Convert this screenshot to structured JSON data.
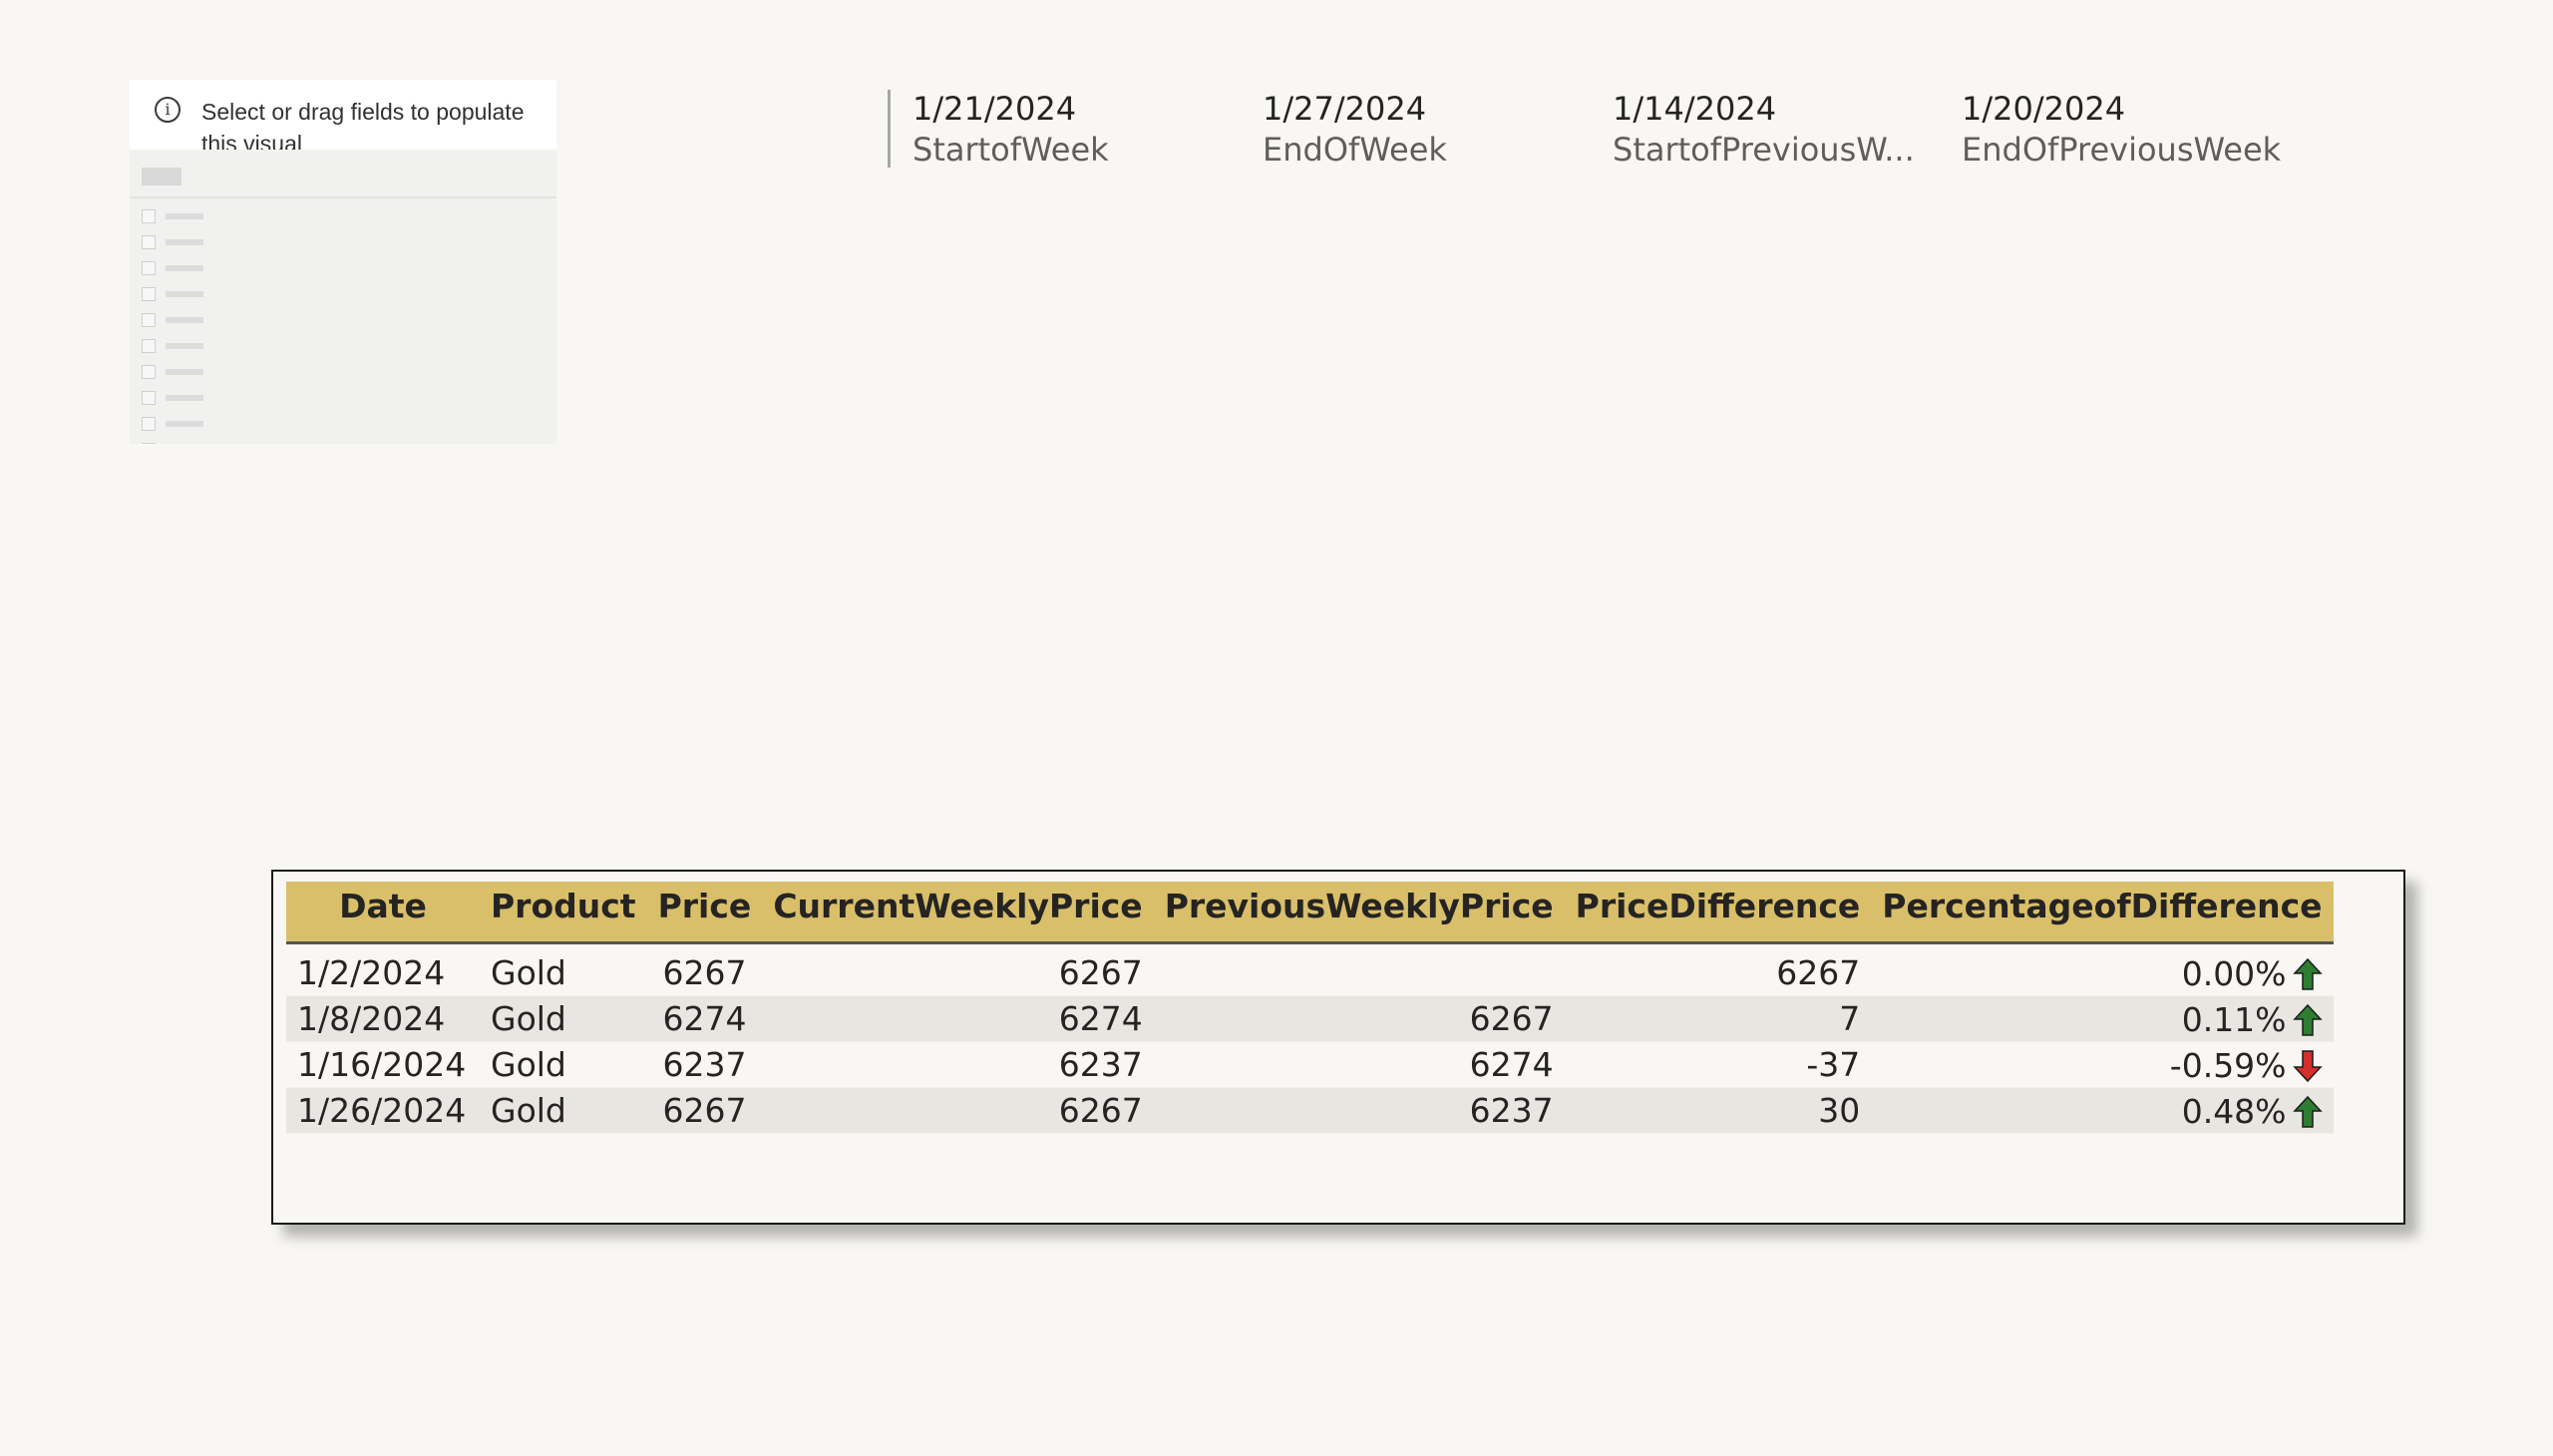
{
  "slicer": {
    "message": "Select or drag fields to populate this visual",
    "icon": "info-icon"
  },
  "cards": [
    {
      "value": "1/21/2024",
      "label": "StartofWeek"
    },
    {
      "value": "1/27/2024",
      "label": "EndOfWeek"
    },
    {
      "value": "1/14/2024",
      "label": "StartofPreviousW..."
    },
    {
      "value": "1/20/2024",
      "label": "EndOfPreviousWeek"
    }
  ],
  "table": {
    "header_color": "#d9bf6a",
    "columns": [
      "Date",
      "Product",
      "Price",
      "CurrentWeeklyPrice",
      "PreviousWeeklyPrice",
      "PriceDifference",
      "PercentageofDifference"
    ],
    "rows": [
      {
        "date": "1/2/2024",
        "product": "Gold",
        "price": "6267",
        "current": "6267",
        "previous": "",
        "difference": "6267",
        "percentage": "0.00%",
        "trend": "up"
      },
      {
        "date": "1/8/2024",
        "product": "Gold",
        "price": "6274",
        "current": "6274",
        "previous": "6267",
        "difference": "7",
        "percentage": "0.11%",
        "trend": "up"
      },
      {
        "date": "1/16/2024",
        "product": "Gold",
        "price": "6237",
        "current": "6237",
        "previous": "6274",
        "difference": "-37",
        "percentage": "-0.59%",
        "trend": "down"
      },
      {
        "date": "1/26/2024",
        "product": "Gold",
        "price": "6267",
        "current": "6267",
        "previous": "6237",
        "difference": "30",
        "percentage": "0.48%",
        "trend": "up"
      }
    ],
    "trend_colors": {
      "up": "#2e7d32",
      "down": "#d32f2f"
    }
  }
}
